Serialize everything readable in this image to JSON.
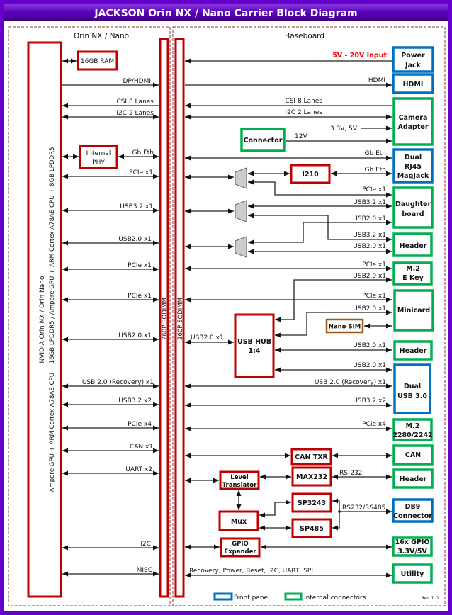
{
  "title": "JACKSON Orin NX / Nano Carrier Block Diagram",
  "colors": {
    "frame": "#6600cc",
    "module": "#c00000",
    "front_panel": "#0070c0",
    "internal": "#00b050",
    "sim": "#9c5a1c",
    "power_label": "#ff0000"
  },
  "module_panel": {
    "heading": "Orin NX / Nano",
    "cpu_lines": [
      "NVIDIA Orin NX / Orin Nano",
      "Ampere GPU + ARM Cortex A78AE CPU + 16GB LPDDR5 / Ampere GPU + ARM Cortex A78AE CPU + 8GB LPDDR5"
    ],
    "ram": "16GB RAM",
    "phy": [
      "Internal",
      "PHY"
    ],
    "sodimm": "260P SODIMM",
    "signals": [
      "DP/HDMI",
      "CSI 8 Lanes",
      "I2C 2 Lanes",
      "Gb Eth",
      "PCIe x1",
      "USB3.2 x1",
      "USB2.0 x1",
      "PCIe x1",
      "PCIe x1",
      "USB2.0 x1",
      "USB 2.0 (Recovery) x1",
      "USB3.2 x2",
      "PCIe x4",
      "CAN x1",
      "UART x2",
      "I2C",
      "MISC"
    ]
  },
  "baseboard": {
    "heading": "Baseboard",
    "sodimm": "260P SODIMM",
    "connectors": {
      "power_jack": [
        "Power",
        "Jack"
      ],
      "hdmi": "HDMI",
      "camera": [
        "Camera",
        "Adapter"
      ],
      "connector": "Connector",
      "rj45": [
        "Dual",
        "RJ45",
        "MagJack"
      ],
      "daughter": [
        "Daughter",
        "board"
      ],
      "header1": "Header",
      "m2e": [
        "M.2",
        "E Key"
      ],
      "minicard": "Minicard",
      "nano_sim": "Nano SIM",
      "header2": "Header",
      "dual_usb": [
        "Dual",
        "USB 3.0"
      ],
      "m2m": [
        "M.2",
        "2280/2242"
      ],
      "can": "CAN",
      "header3": "Header",
      "db9": [
        "DB9",
        "Connector"
      ],
      "gpio": [
        "16x GPIO",
        "3.3V/5V"
      ],
      "utility": "Utility"
    },
    "chips": {
      "i210": "I210",
      "usb_hub": [
        "USB HUB",
        "1:4"
      ],
      "can_txr": "CAN TXR",
      "level_translator": [
        "Level",
        "Translator"
      ],
      "max232": "MAX232",
      "mux": "Mux",
      "sp3243": "SP3243",
      "sp485": "SP485",
      "gpio_expander": [
        "GPIO",
        "Expander"
      ]
    },
    "signals": {
      "power": "5V - 20V Input",
      "hdmi": "HDMI",
      "csi": "CSI 8 Lanes",
      "i2c": "I2C 2 Lanes",
      "cam_power": "3.3V, 5V",
      "v12": "12V",
      "gbeth1": "Gb Eth",
      "gbeth2": "Gb Eth",
      "db_pcie": "PCIe x1",
      "db_usb3": "USB3.2 x1",
      "db_usb2": "USB2.0 x1",
      "hdr_usb3": "USB3.2 x1",
      "hdr_usb2": "USB2.0 x1",
      "m2e_pcie": "PCIe x1",
      "m2e_usb2": "USB2.0 x1",
      "mc_pcie": "PCIe x1",
      "mc_usb2": "USB2.0 x1",
      "hub_in": "USB2.0 x1",
      "hdr2_usb2": "USB2.0 x1",
      "dusb_usb2": "USB2.0 x1",
      "recovery": "USB 2.0 (Recovery) x1",
      "usb3x2": "USB3.2 x2",
      "pcie4": "PCIe x4",
      "rs232": "RS-232",
      "rs485": "RS232/RS485",
      "utility": "Recovery, Power, Reset, I2C, UART, SPI"
    }
  },
  "legend": [
    {
      "label": "Front panel",
      "color": "#0070c0"
    },
    {
      "label": "Internal connectors",
      "color": "#00b050"
    }
  ],
  "revision": "Rev 1.0"
}
